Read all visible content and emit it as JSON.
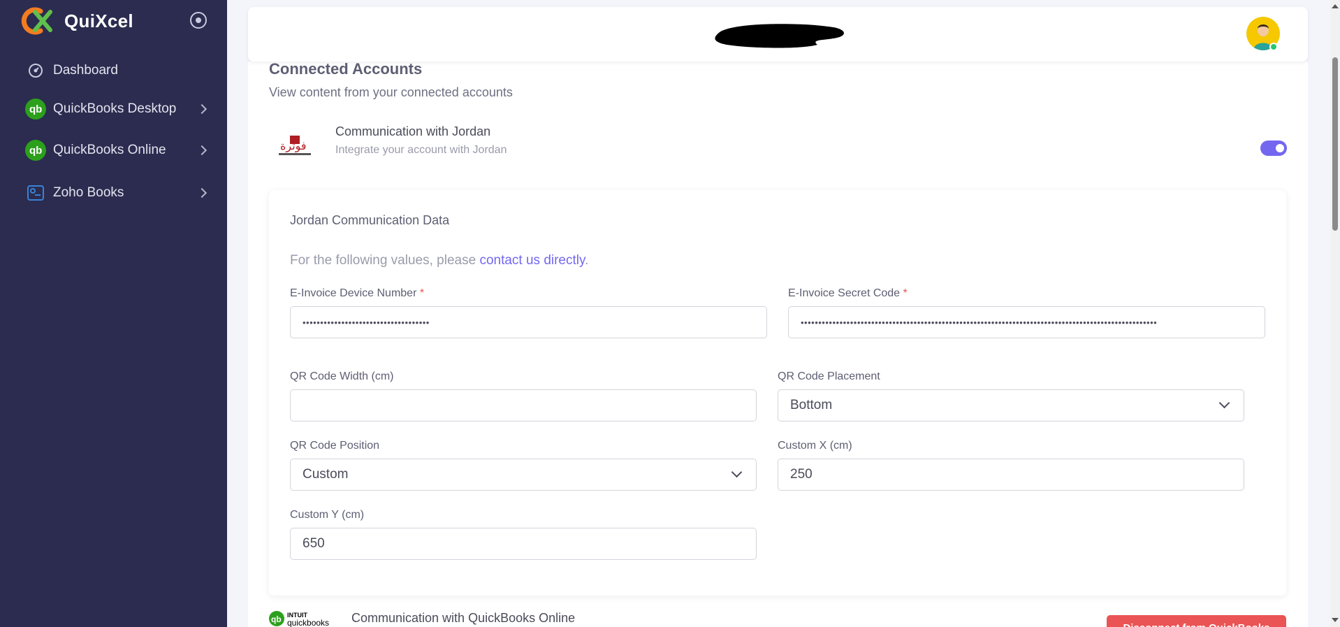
{
  "app": {
    "name": "QuiXcel"
  },
  "sidebar": {
    "items": [
      {
        "label": "Dashboard",
        "icon": "dashboard-icon"
      },
      {
        "label": "QuickBooks Desktop",
        "icon": "quickbooks-icon"
      },
      {
        "label": "QuickBooks Online",
        "icon": "quickbooks-icon"
      },
      {
        "label": "Zoho Books",
        "icon": "zoho-books-icon"
      }
    ]
  },
  "page": {
    "title": "Connected Accounts",
    "subtitle": "View content from your connected accounts"
  },
  "account": {
    "title": "Communication with Jordan",
    "subtitle": "Integrate your account with Jordan",
    "logo_text": "فوترة",
    "enabled": true
  },
  "panel": {
    "title": "Jordan Communication Data",
    "note_prefix": "For the following values, please",
    "note_link": "contact us directly",
    "note_suffix": ".",
    "fields": {
      "device_number": {
        "label": "E-Invoice Device Number",
        "required": "*",
        "value": "••••••••••••••••••••••••••••••••••••"
      },
      "secret_code": {
        "label": "E-Invoice Secret Code",
        "required": "*",
        "value": "•••••••••••••••••••••••••••••••••••••••••••••••••••••••••••••••••••••••••••••••••••••••••••••••••••••"
      },
      "qr_width": {
        "label": "QR Code Width (cm)",
        "value": ""
      },
      "qr_placement": {
        "label": "QR Code Placement",
        "value": "Bottom"
      },
      "qr_position": {
        "label": "QR Code Position",
        "value": "Custom"
      },
      "custom_x": {
        "label": "Custom X (cm)",
        "value": "250"
      },
      "custom_y": {
        "label": "Custom Y (cm)",
        "value": "650"
      }
    }
  },
  "next_account": {
    "title": "Communication with QuickBooks Online",
    "logo_text_top": "INTUIT",
    "logo_text_bottom": "quickbooks",
    "button_label": "Disconnect from QuickBooks"
  },
  "colors": {
    "sidebar_bg": "#2b2c4f",
    "accent": "#7367f0",
    "danger": "#ea5455",
    "quickbooks_green": "#2ca01c"
  }
}
